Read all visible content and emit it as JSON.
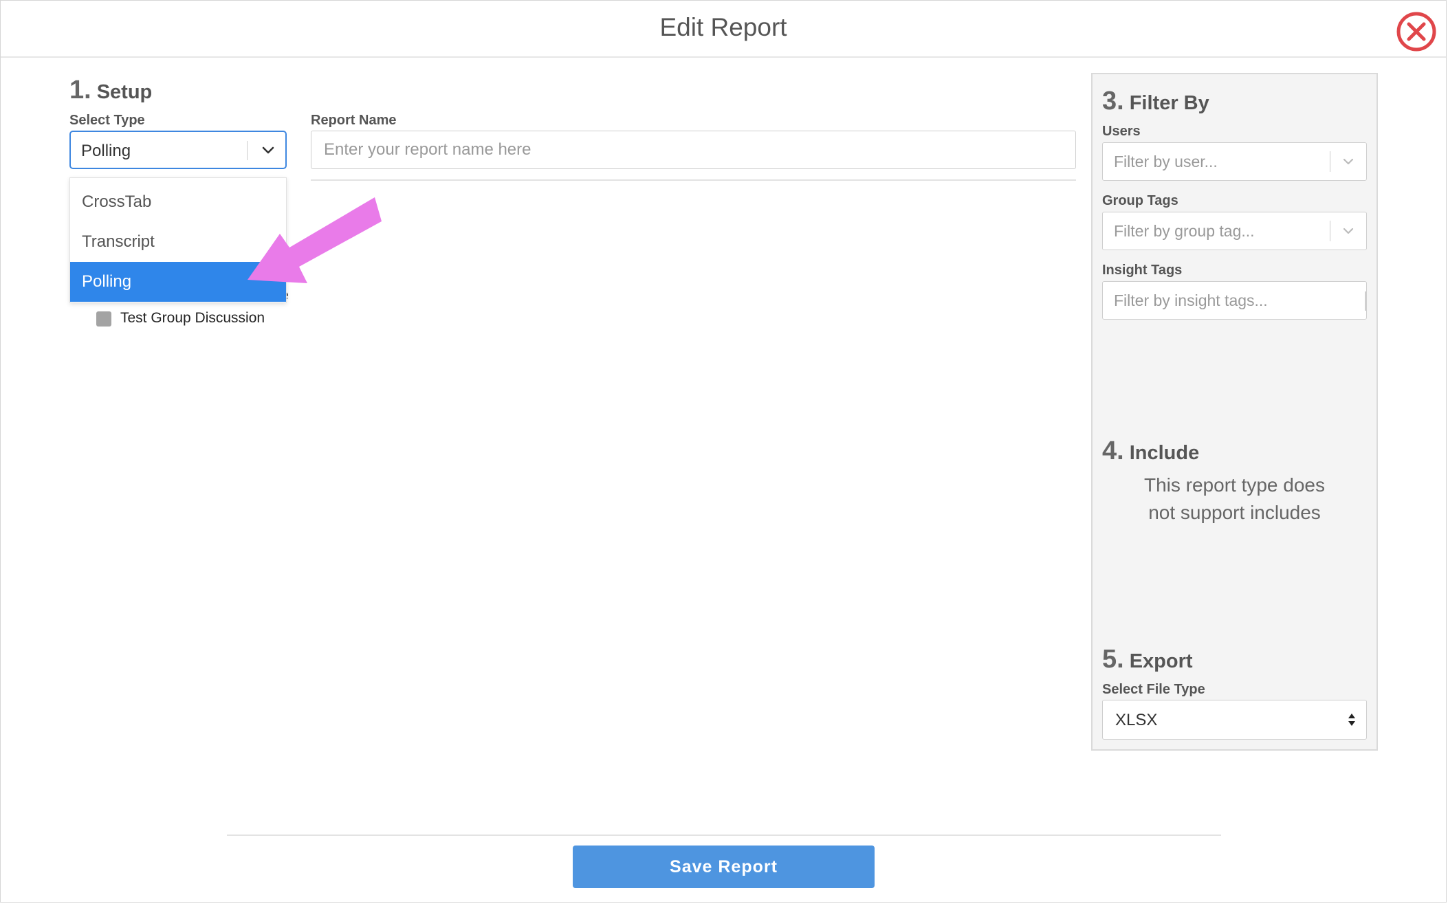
{
  "header": {
    "title": "Edit Report"
  },
  "setup": {
    "num": "1.",
    "title": "Setup",
    "select_type_label": "Select Type",
    "select_type_value": "Polling",
    "report_name_label": "Report Name",
    "report_name_placeholder": "Enter your report name here",
    "dropdown_options": [
      "CrossTab",
      "Transcript",
      "Polling"
    ],
    "obscured_text": "e",
    "checkbox_label": "Test Group Discussion"
  },
  "filter": {
    "num": "3.",
    "title": "Filter By",
    "users_label": "Users",
    "users_placeholder": "Filter by user...",
    "group_tags_label": "Group Tags",
    "group_tags_placeholder": "Filter by group tag...",
    "insight_tags_label": "Insight Tags",
    "insight_tags_placeholder": "Filter by insight tags..."
  },
  "include": {
    "num": "4.",
    "title": "Include",
    "line1": "This report type does",
    "line2": "not support includes"
  },
  "export": {
    "num": "5.",
    "title": "Export",
    "file_type_label": "Select File Type",
    "file_type_value": "XLSX"
  },
  "footer": {
    "save_label": "Save Report"
  },
  "colors": {
    "accent": "#2f86ea",
    "button": "#4e95e0",
    "close": "#e0464a",
    "annotation_arrow": "#e97be9"
  }
}
